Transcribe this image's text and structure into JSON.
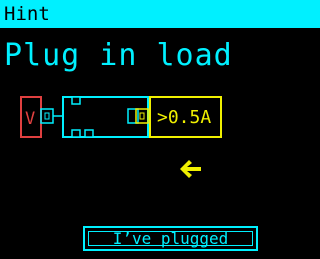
{
  "dialog": {
    "title": "Hint",
    "message": "Plug in load"
  },
  "diagram": {
    "source_label": "V",
    "load_label": ">0.5A",
    "colors": {
      "source": "#e04040",
      "cable": "#00f0ff",
      "load": "#f0f000"
    },
    "arrow_icon": "arrow-left-icon",
    "arrow_color": "#f0f000"
  },
  "actions": {
    "confirm_label": "I’ve plugged"
  },
  "colors": {
    "accent": "#00f0ff",
    "background": "#000000"
  }
}
